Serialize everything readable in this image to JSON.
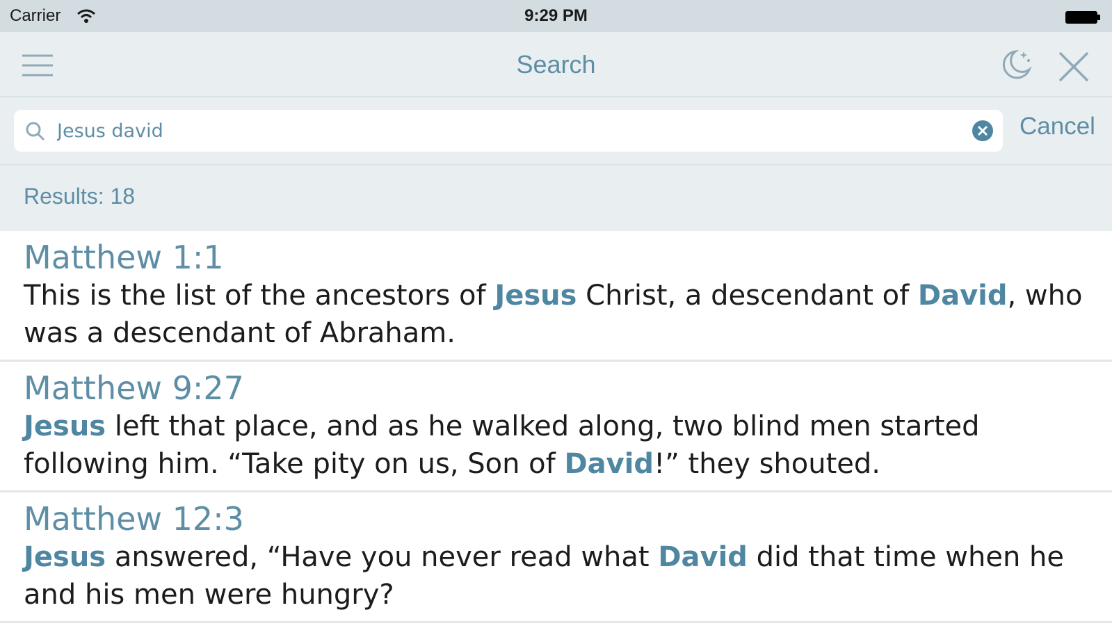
{
  "status_bar": {
    "carrier": "Carrier",
    "time": "9:29 PM",
    "wifi_icon": "wifi-icon",
    "battery_icon": "battery-icon"
  },
  "nav_bar": {
    "title": "Search",
    "menu_icon": "hamburger-menu-icon",
    "night_mode_icon": "moon-stars-icon",
    "close_icon": "close-icon"
  },
  "search": {
    "query": "Jesus david",
    "search_icon": "magnifier-icon",
    "clear_icon": "clear-circle-icon",
    "cancel_label": "Cancel"
  },
  "results": {
    "count_label": "Results: 18",
    "items": [
      {
        "reference": "Matthew 1:1",
        "segments": [
          {
            "text": "This is the list of the ancestors of ",
            "highlight": false
          },
          {
            "text": "Jesus",
            "highlight": true
          },
          {
            "text": " Christ, a descendant of ",
            "highlight": false
          },
          {
            "text": "David",
            "highlight": true
          },
          {
            "text": ", who was a descendant of Abraham.",
            "highlight": false
          }
        ]
      },
      {
        "reference": "Matthew 9:27",
        "segments": [
          {
            "text": "Jesus",
            "highlight": true
          },
          {
            "text": " left that place, and as he walked along, two blind men started following him. “Take pity on us, Son of ",
            "highlight": false
          },
          {
            "text": "David",
            "highlight": true
          },
          {
            "text": "!” they shouted.",
            "highlight": false
          }
        ]
      },
      {
        "reference": "Matthew 12:3",
        "segments": [
          {
            "text": "Jesus",
            "highlight": true
          },
          {
            "text": " answered, “Have you never read what ",
            "highlight": false
          },
          {
            "text": "David",
            "highlight": true
          },
          {
            "text": " did that time when he and his men were hungry?",
            "highlight": false
          }
        ]
      }
    ]
  },
  "colors": {
    "accent": "#5e8ea5",
    "highlight": "#4f86a1",
    "bar_background": "#e9eef1",
    "status_background": "#d3dce1"
  }
}
